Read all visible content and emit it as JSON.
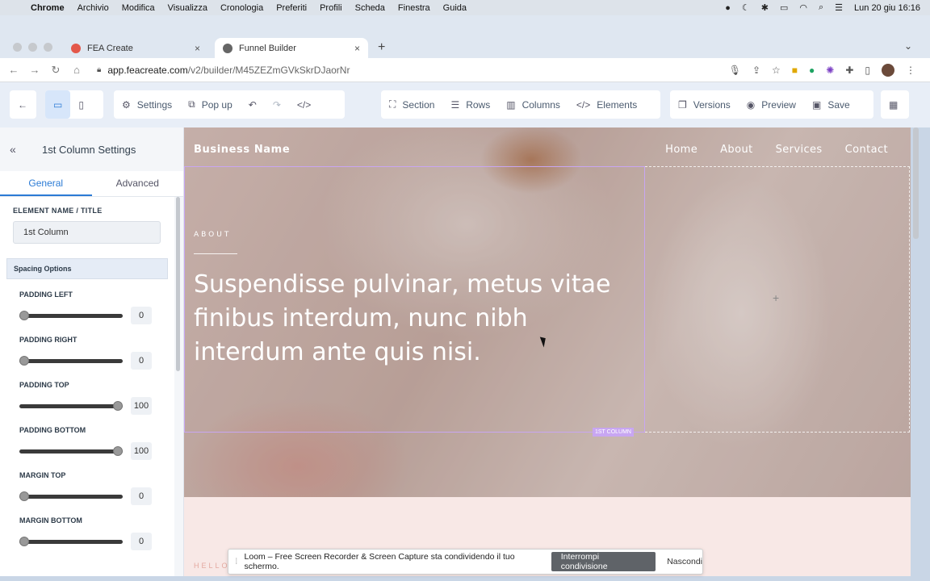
{
  "mac_menu": {
    "app": "Chrome",
    "items": [
      "Archivio",
      "Modifica",
      "Visualizza",
      "Cronologia",
      "Preferiti",
      "Profili",
      "Scheda",
      "Finestra",
      "Guida"
    ],
    "clock": "Lun 20 giu  16:16"
  },
  "browser": {
    "tabs": [
      {
        "label": "FEA Create"
      },
      {
        "label": "Funnel Builder"
      }
    ],
    "url_host": "app.feacreate.com",
    "url_path": "/v2/builder/M45ZEZmGVkSkrDJaorNr"
  },
  "toolbar": {
    "settings": "Settings",
    "popup": "Pop up",
    "section": "Section",
    "rows": "Rows",
    "columns": "Columns",
    "elements": "Elements",
    "versions": "Versions",
    "preview": "Preview",
    "save": "Save"
  },
  "panel": {
    "title": "1st Column Settings",
    "tabs": [
      "General",
      "Advanced"
    ],
    "name_label": "ELEMENT NAME / TITLE",
    "name_value": "1st Column",
    "spacing_title": "Spacing Options",
    "sliders": [
      {
        "label": "PADDING LEFT",
        "value": "0",
        "fraction": 0.0
      },
      {
        "label": "PADDING RIGHT",
        "value": "0",
        "fraction": 0.0
      },
      {
        "label": "PADDING TOP",
        "value": "100",
        "fraction": 1.0
      },
      {
        "label": "PADDING BOTTOM",
        "value": "100",
        "fraction": 1.0
      },
      {
        "label": "MARGIN TOP",
        "value": "0",
        "fraction": 0.0
      },
      {
        "label": "MARGIN BOTTOM",
        "value": "0",
        "fraction": 0.0
      }
    ]
  },
  "site": {
    "brand": "Business Name",
    "nav": [
      "Home",
      "About",
      "Services",
      "Contact"
    ],
    "eyebrow": "ABOUT",
    "headline": "Suspendisse pulvinar, metus vitae finibus interdum, nunc nibh interdum ante quis nisi.",
    "column_tag": "1ST COLUMN",
    "next_eyebrow": "HELLO"
  },
  "loom": {
    "message": "Loom – Free Screen Recorder & Screen Capture sta condividendo il tuo schermo.",
    "stop": "Interrompi condivisione",
    "hide": "Nascondi"
  }
}
